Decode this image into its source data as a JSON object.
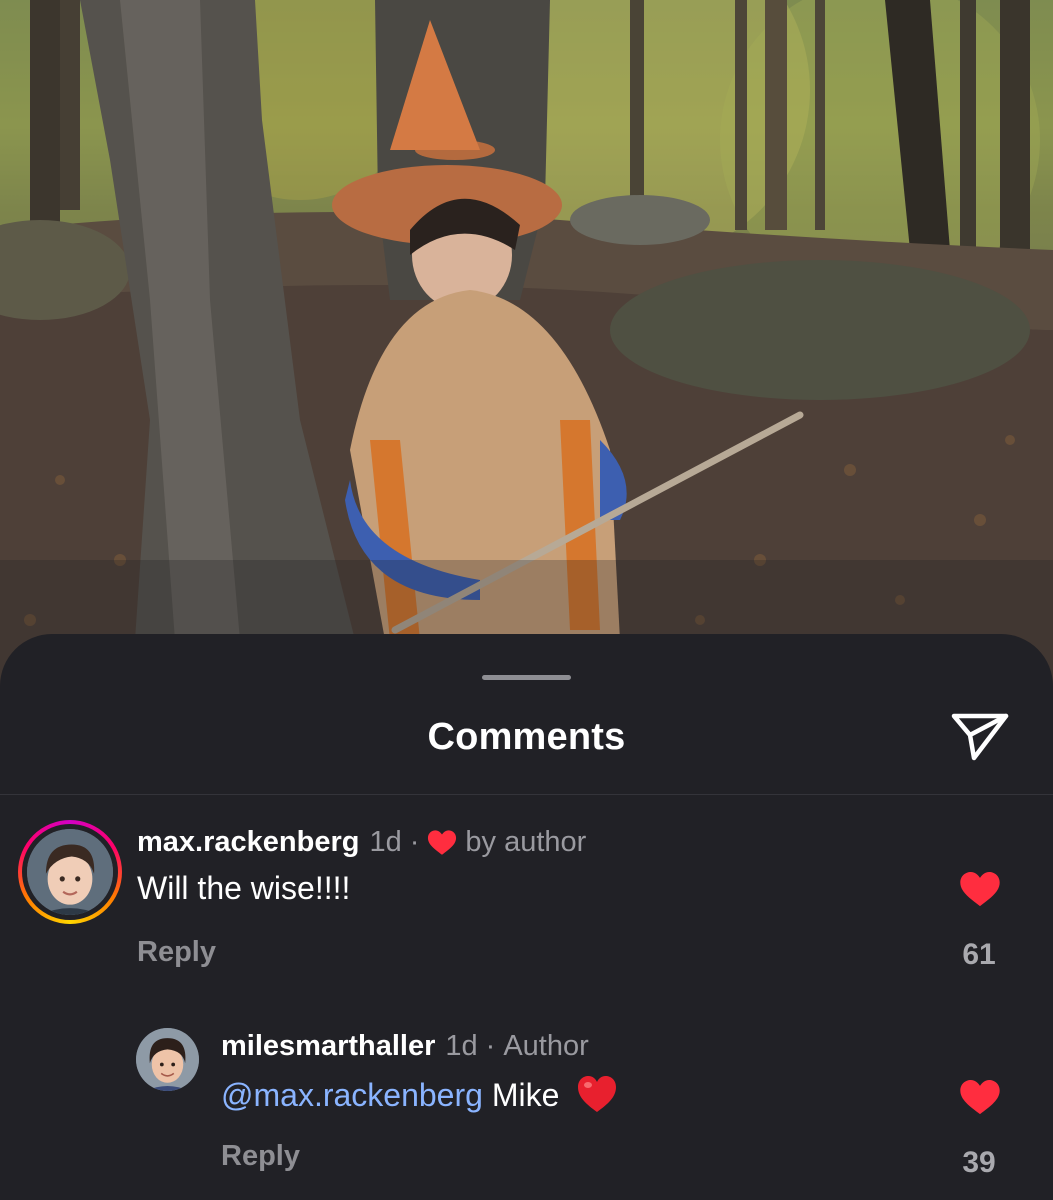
{
  "sheet": {
    "title": "Comments"
  },
  "comments": [
    {
      "username": "max.rackenberg",
      "time": "1d",
      "separator": "·",
      "liked_by": "by author",
      "text": "Will the wise!!!!",
      "reply_label": "Reply",
      "likes": "61"
    }
  ],
  "replies": [
    {
      "username": "milesmarthaller",
      "time": "1d",
      "separator": "·",
      "badge": "Author",
      "mention": "@max.rackenberg",
      "text": "Mike",
      "reply_label": "Reply",
      "likes": "39"
    }
  ],
  "icons": {
    "share": "paper-plane-icon",
    "like": "heart-icon",
    "emoji": "red-heart-emoji"
  },
  "colors": {
    "sheet_background": "#212126",
    "heart": "#ff2d3f",
    "mention": "#8ab4ff",
    "muted_text": "#9a9aa0"
  }
}
